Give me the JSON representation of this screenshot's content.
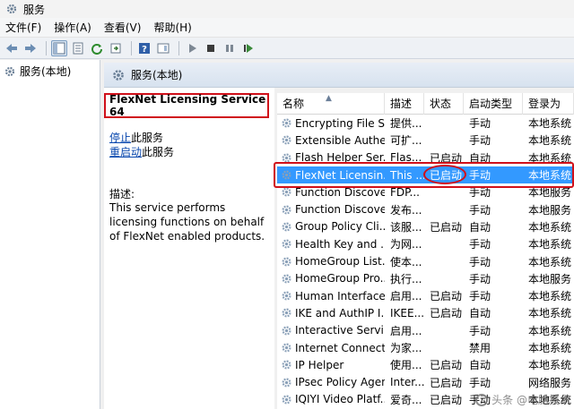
{
  "window": {
    "title": "服务"
  },
  "menu": [
    "文件(F)",
    "操作(A)",
    "查看(V)",
    "帮助(H)"
  ],
  "tree": {
    "root_label": "服务(本地)"
  },
  "main": {
    "header_label": "服务(本地)"
  },
  "detail": {
    "service_name": "FlexNet Licensing Service 64",
    "stop_link": "停止",
    "stop_suffix": "此服务",
    "restart_link": "重启动",
    "restart_suffix": "此服务",
    "desc_label": "描述:",
    "desc_text": "This service performs licensing functions on behalf of FlexNet enabled products."
  },
  "table": {
    "columns": [
      "名称",
      "描述",
      "状态",
      "启动类型",
      "登录为"
    ],
    "rows": [
      [
        "Encrypting File S...",
        "提供...",
        "",
        "手动",
        "本地系统"
      ],
      [
        "Extensible Authe...",
        "可扩...",
        "",
        "手动",
        "本地系统"
      ],
      [
        "Flash Helper Ser...",
        "Flas...",
        "已启动",
        "自动",
        "本地系统"
      ],
      [
        "FlexNet Licensin...",
        "This ...",
        "已启动",
        "手动",
        "本地系统"
      ],
      [
        "Function Discove...",
        "FDP...",
        "",
        "手动",
        "本地服务"
      ],
      [
        "Function Discove...",
        "发布...",
        "",
        "手动",
        "本地服务"
      ],
      [
        "Group Policy Cli...",
        "该服...",
        "已启动",
        "自动",
        "本地系统"
      ],
      [
        "Health Key and ...",
        "为网...",
        "",
        "手动",
        "本地系统"
      ],
      [
        "HomeGroup List...",
        "使本...",
        "",
        "手动",
        "本地系统"
      ],
      [
        "HomeGroup Pro...",
        "执行...",
        "",
        "手动",
        "本地服务"
      ],
      [
        "Human Interface...",
        "启用...",
        "已启动",
        "手动",
        "本地系统"
      ],
      [
        "IKE and AuthIP I...",
        "IKEE...",
        "已启动",
        "自动",
        "本地系统"
      ],
      [
        "Interactive Servi...",
        "启用...",
        "",
        "手动",
        "本地系统"
      ],
      [
        "Internet Connect...",
        "为家...",
        "",
        "禁用",
        "本地系统"
      ],
      [
        "IP Helper",
        "使用...",
        "已启动",
        "自动",
        "本地系统"
      ],
      [
        "IPsec Policy Agent",
        "Inter...",
        "已启动",
        "手动",
        "网络服务"
      ],
      [
        "IQIYI Video Platf...",
        "爱奇...",
        "已启动",
        "手动",
        "本地系统"
      ]
    ],
    "selected_index": 3
  },
  "watermark": "头条 @电脑技术",
  "colors": {
    "selection": "#3399ff",
    "highlight": "#d0101a",
    "link": "#0645ad"
  }
}
